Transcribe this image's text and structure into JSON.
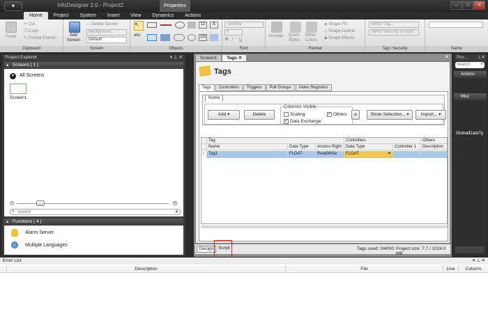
{
  "titlebar": {
    "app_title": "InfoDesigner 2.0 - Project2",
    "context_tab": "Properties",
    "app_button": "▾",
    "min": "–",
    "max": "□",
    "close": "✕"
  },
  "ribbon_tabs": [
    "Home",
    "Project",
    "System",
    "Insert",
    "View",
    "Dynamics",
    "Actions"
  ],
  "clipboard": {
    "paste": "Paste",
    "cut": "Cut",
    "copy": "Copy",
    "format_painter": "Format Painter",
    "label": "Clipboard"
  },
  "screen": {
    "add_screen": "Add\nScreen",
    "delete_screen": "Delete Screen",
    "background": "Background...",
    "default": "Default",
    "label": "Screen"
  },
  "objects": {
    "label": "Objects",
    "abc": "abc",
    "btn12": "12",
    "btn123": "123",
    "btnA": "A"
  },
  "font": {
    "family": "Tahoma",
    "size": "8",
    "bold": "B",
    "italic": "I",
    "underline": "U",
    "label": "Font"
  },
  "format": {
    "arrange": "Arrange",
    "quick_styles": "Quick\nStyles",
    "other_colors": "Other\nColors",
    "shape_fill": "Shape Fill",
    "shape_outline": "Shape Outline",
    "shape_effects": "Shape Effects",
    "label": "Format"
  },
  "tag_security": {
    "select_tag": "Select Tag...",
    "select_groups": "Select Security Groups...",
    "label": "Tag / Security"
  },
  "name_group": {
    "label": "Name"
  },
  "project_explorer": {
    "title": "Project Explorer",
    "screens_header": "Screens ( 1 )",
    "all_screens": "All Screens",
    "screen1": "Screen1",
    "search_placeholder": "Search",
    "functions_header": "Functions ( 4 )",
    "functions": [
      "Alarm Server",
      "Multiple Languages"
    ]
  },
  "doc_tabs": [
    "Screen1",
    "Tags"
  ],
  "tags_panel": {
    "title": "Tags",
    "inner_tabs": [
      "Tags",
      "Controllers",
      "Triggers",
      "Poll Groups",
      "Index Registers"
    ],
    "home_tab": "Home",
    "add": "Add",
    "delete": "Delete",
    "columns_visible": "Columns Visible",
    "scaling": "Scaling",
    "data_exchange": "Data Exchange",
    "others": "Others",
    "show_selection": "Show Selection...",
    "import": "Import...",
    "partial_btn": "e"
  },
  "grid": {
    "group_headers": [
      "Tag",
      "Controllers",
      "Others"
    ],
    "columns": [
      "Name",
      "Data Type",
      "Access Right",
      "Data Type",
      "Controller 1",
      "Description"
    ],
    "rows": [
      [
        "Tag1",
        "FLOAT",
        "ReadWrite",
        "FLOAT",
        "",
        ""
      ]
    ]
  },
  "bottom_tabs": [
    "Design",
    "Script"
  ],
  "status": {
    "tags_used": "Tags used: 0/4000",
    "project_size": "Project size: 7.7 / 1024.0 MB"
  },
  "right_panel": {
    "title": "Pro...",
    "search_placeholder": "Search",
    "actions": "Actions",
    "misc": "Misc",
    "global_data": "GlobalDataTy"
  },
  "error_list": {
    "title": "Error List",
    "columns": [
      "Description",
      "File",
      "Line",
      "Column"
    ]
  },
  "colors": {
    "accent_blue": "#a8c8f0",
    "highlight_red": "#e02020"
  }
}
